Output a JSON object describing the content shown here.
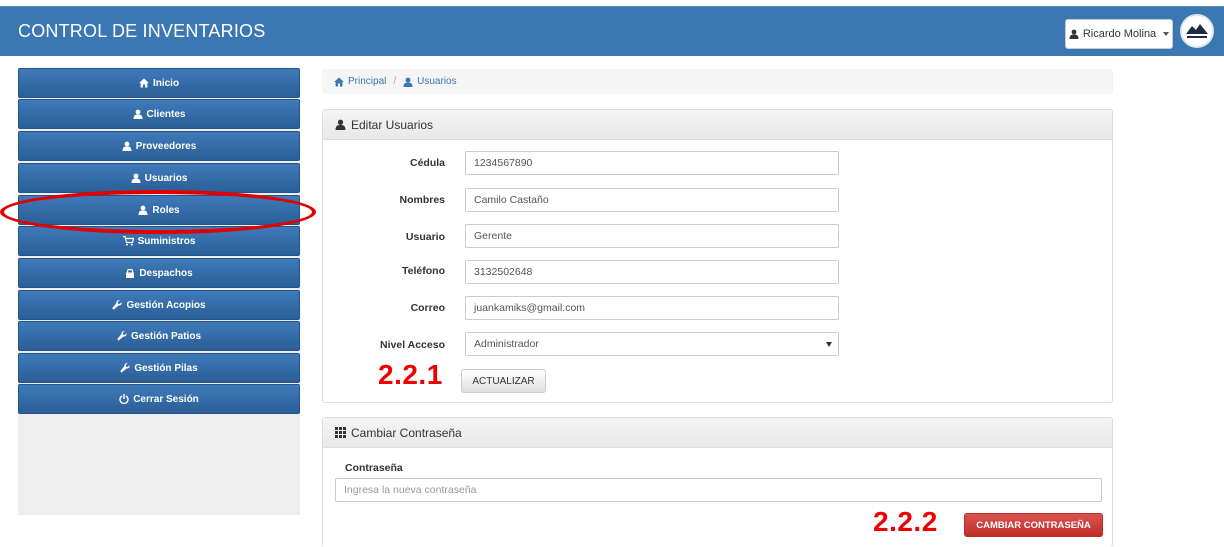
{
  "header": {
    "brand": "CONTROL DE INVENTARIOS",
    "user_name": "Ricardo Molina",
    "bg_color": "#3b77b3"
  },
  "sidebar": {
    "items": [
      {
        "label": "Inicio",
        "icon": "home-icon"
      },
      {
        "label": "Clientes",
        "icon": "user-icon"
      },
      {
        "label": "Proveedores",
        "icon": "user-icon"
      },
      {
        "label": "Usuarios",
        "icon": "user-icon"
      },
      {
        "label": "Roles",
        "icon": "user-icon"
      },
      {
        "label": "Suministros",
        "icon": "cart-icon"
      },
      {
        "label": "Despachos",
        "icon": "lock-icon"
      },
      {
        "label": "Gestión Acopios",
        "icon": "wrench-icon"
      },
      {
        "label": "Gestión Patios",
        "icon": "wrench-icon"
      },
      {
        "label": "Gestión Pilas",
        "icon": "wrench-icon"
      },
      {
        "label": "Cerrar Sesión",
        "icon": "power-icon"
      }
    ]
  },
  "breadcrumb": {
    "home": "Principal",
    "current": "Usuarios"
  },
  "edit_panel": {
    "title": "Editar Usuarios",
    "fields": [
      {
        "label": "Cédula",
        "value": "1234567890"
      },
      {
        "label": "Nombres",
        "value": "Camilo Castaño"
      },
      {
        "label": "Usuario",
        "value": "Gerente"
      },
      {
        "label": "Teléfono",
        "value": "3132502648"
      },
      {
        "label": "Correo",
        "value": "juankamiks@gmail.com"
      }
    ],
    "access_label": "Nivel Acceso",
    "access_value": "Administrador",
    "update_button": "ACTUALIZAR"
  },
  "password_panel": {
    "title": "Cambiar Contraseña",
    "label": "Contraseña",
    "placeholder": "Ingresa la nueva contraseña",
    "button": "CAMBIAR CONTRASEÑA"
  },
  "annotations": {
    "step1": "2.2.1",
    "step2": "2.2.2",
    "color": "#ee0000"
  }
}
